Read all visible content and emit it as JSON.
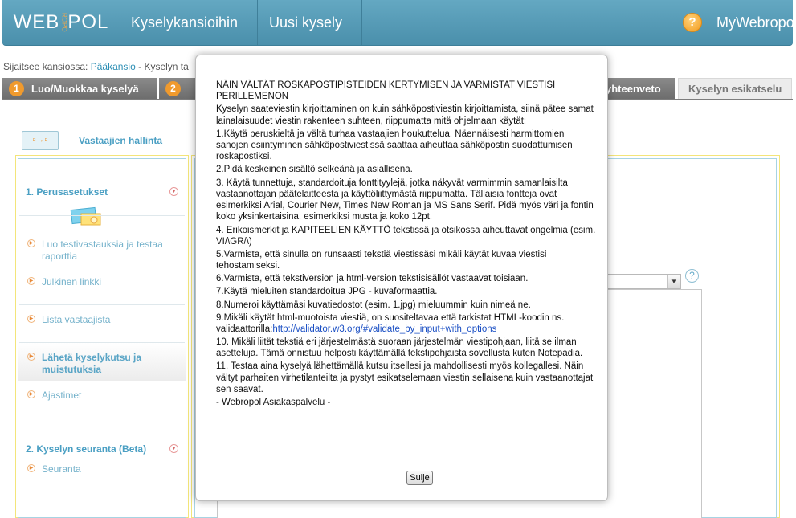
{
  "header": {
    "logo_left": "WEB",
    "logo_ro": "ROPO",
    "logo_right": "POL",
    "nav": [
      "Kyselykansioihin",
      "Uusi kysely"
    ],
    "help_label": "?",
    "account_label": "MyWebropol"
  },
  "breadcrumb": {
    "prefix": "Sijaitsee kansiossa: ",
    "folder": "Pääkansio",
    "rest": " - Kyselyn ta"
  },
  "tabs": [
    {
      "number": "1",
      "label": "Luo/Muokkaa kyselyä"
    },
    {
      "number": "2",
      "label": ""
    },
    {
      "label": "yhteenveto"
    },
    {
      "label": "Kyselyn esikatselu"
    }
  ],
  "sidebar": {
    "respondent_icon": "▫→▫",
    "respondent_link": "Vastaajien hallinta",
    "section1_title": "1. Perusasetukset",
    "items": [
      {
        "label": "Luo testivastauksia ja testaa raporttia"
      },
      {
        "label": "Julkinen linkki"
      },
      {
        "label": "Lista vastaajista"
      },
      {
        "label": "Lähetä kyselykutsu ja muistutuksia"
      },
      {
        "label": "Ajastimet"
      }
    ],
    "section2_title": "2. Kyselyn seuranta (Beta)",
    "section2_items": [
      {
        "label": "Seuranta"
      }
    ]
  },
  "workspace": {
    "help_label": "?"
  },
  "modal": {
    "title_line": "NÄIN VÄLTÄT ROSKAPOSTIPISTEIDEN KERTYMISEN JA VARMISTAT VIESTISI PERILLEMENON",
    "intro": "Kyselyn saateviestin kirjoittaminen on kuin sähköpostiviestin kirjoittamista, siinä pätee samat lainalaisuudet viestin rakenteen suhteen, riippumatta mitä ohjelmaan käytät:",
    "tips": [
      "1.Käytä peruskieltä ja vältä turhaa vastaajien houkuttelua. Näennäisesti harmittomien sanojen esiintyminen sähköpostiviestissä saattaa aiheuttaa sähköpostin suodattumisen roskapostiksi.",
      "2.Pidä keskeinen sisältö selkeänä ja asiallisena.",
      "3. Käytä tunnettuja, standardoituja fonttityylejä, jotka näkyvät varmimmin samanlaisilta vastaanottajan päätelaitteesta ja käyttöliittymästä riippumatta. Tällaisia fontteja ovat esimerkiksi Arial, Courier New, Times New Roman ja MS Sans Serif. Pidä myös väri ja fontin koko yksinkertaisina, esimerkiksi musta ja koko 12pt.",
      "4. Erikoismerkit ja KAPITEELIEN KÄYTTÖ tekstissä ja otsikossa aiheuttavat ongelmia (esim. VI/\\GR/\\)",
      "5.Varmista, että sinulla on runsaasti tekstiä viestissäsi mikäli käytät kuvaa viestisi tehostamiseksi.",
      "6.Varmista, että tekstiversion ja html-version tekstisisällöt vastaavat toisiaan.",
      "7.Käytä mieluiten standardoitua JPG - kuvaformaattia.",
      "8.Numeroi käyttämäsi kuvatiedostot (esim. 1.jpg) mieluummin kuin nimeä ne."
    ],
    "tip9_text": "9.Mikäli käytät html-muotoista viestiä, on suositeltavaa että tarkistat HTML-koodin ns. validaattorilla:",
    "tip9_link": "http://validator.w3.org/#validate_by_input+with_options",
    "tips_after": [
      "10. Mikäli liität tekstiä eri järjestelmästä suoraan järjestelmän viestipohjaan, liitä se ilman asetteluja. Tämä onnistuu helposti käyttämällä tekstipohjaista sovellusta kuten Notepadia.",
      "11. Testaa aina kyselyä lähettämällä kutsu itsellesi ja mahdollisesti myös kollegallesi. Näin vältyt parhaiten virhetilanteilta ja pystyt esikatselemaan viestin sellaisena kuin vastaanottajat sen saavat."
    ],
    "signature": "- Webropol Asiakaspalvelu -",
    "close_label": "Sulje"
  },
  "colors": {
    "header_bg": "#4f96b2",
    "tab_active": "#7a7a7a",
    "accent_orange": "#f09a2d",
    "link_blue": "#4a9fc3"
  }
}
